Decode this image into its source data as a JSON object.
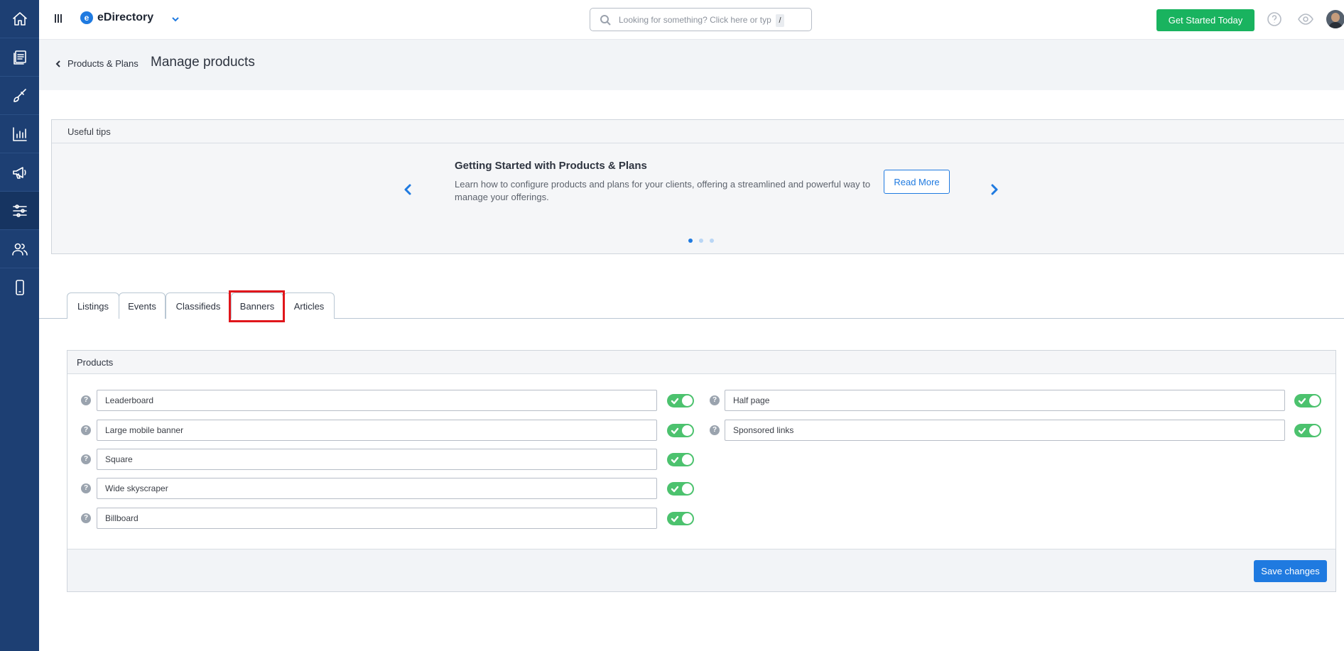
{
  "topbar": {
    "brand": "eDirectory",
    "search_placeholder": "Looking for something? Click here or type",
    "search_shortcut": "/",
    "cta_label": "Get Started Today"
  },
  "header": {
    "back_label": "Products & Plans",
    "title": "Manage products"
  },
  "tips": {
    "heading": "Useful tips",
    "title": "Getting Started with Products & Plans",
    "body": "Learn how to configure products and plans for your clients, offering a streamlined and powerful way to manage your offerings.",
    "read_more": "Read More",
    "slides": 3,
    "active_slide": 1
  },
  "tabs": [
    {
      "label": "Listings"
    },
    {
      "label": "Events"
    },
    {
      "label": "Classifieds"
    },
    {
      "label": "Banners",
      "highlighted": true
    },
    {
      "label": "Articles"
    }
  ],
  "products": {
    "heading": "Products",
    "left": [
      {
        "name": "Leaderboard",
        "enabled": true
      },
      {
        "name": "Large mobile banner",
        "enabled": true
      },
      {
        "name": "Square",
        "enabled": true
      },
      {
        "name": "Wide skyscraper",
        "enabled": true
      },
      {
        "name": "Billboard",
        "enabled": true
      }
    ],
    "right": [
      {
        "name": "Half page",
        "enabled": true
      },
      {
        "name": "Sponsored links",
        "enabled": true
      }
    ],
    "save_label": "Save changes"
  },
  "colors": {
    "sidebar": "#1d3f73",
    "accent": "#1f7ae0",
    "cta": "#19b35f",
    "toggle_on": "#4cc26e",
    "highlight": "#e0161b"
  }
}
